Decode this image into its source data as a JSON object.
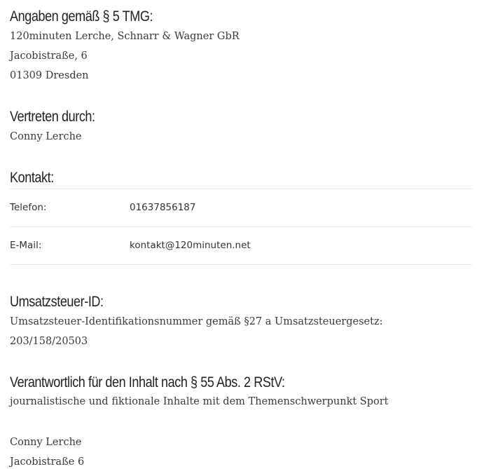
{
  "sections": {
    "angaben": {
      "heading": "Angaben gemäß § 5 TMG:",
      "lines": [
        "120minuten Lerche, Schnarr & Wagner GbR",
        "Jacobistraße, 6",
        "01309 Dresden"
      ]
    },
    "vertreten": {
      "heading": "Vertreten durch:",
      "lines": [
        "Conny Lerche"
      ]
    },
    "kontakt": {
      "heading": "Kontakt:",
      "rows": [
        {
          "label": "Telefon:",
          "value": "01637856187"
        },
        {
          "label": "E-Mail:",
          "value": "kontakt@120minuten.net"
        }
      ]
    },
    "umsatz": {
      "heading": "Umsatzsteuer-ID:",
      "lines": [
        "Umsatzsteuer-Identifikationsnummer gemäß §27 a Umsatzsteuergesetz:",
        "203/158/20503"
      ]
    },
    "verantwortlich": {
      "heading": "Verantwortlich für den Inhalt nach § 55 Abs. 2 RStV:",
      "lines": [
        "journalistische und fiktionale Inhalte mit dem Themenschwerpunkt Sport",
        "Conny Lerche",
        "Jacobistraße 6"
      ]
    }
  }
}
